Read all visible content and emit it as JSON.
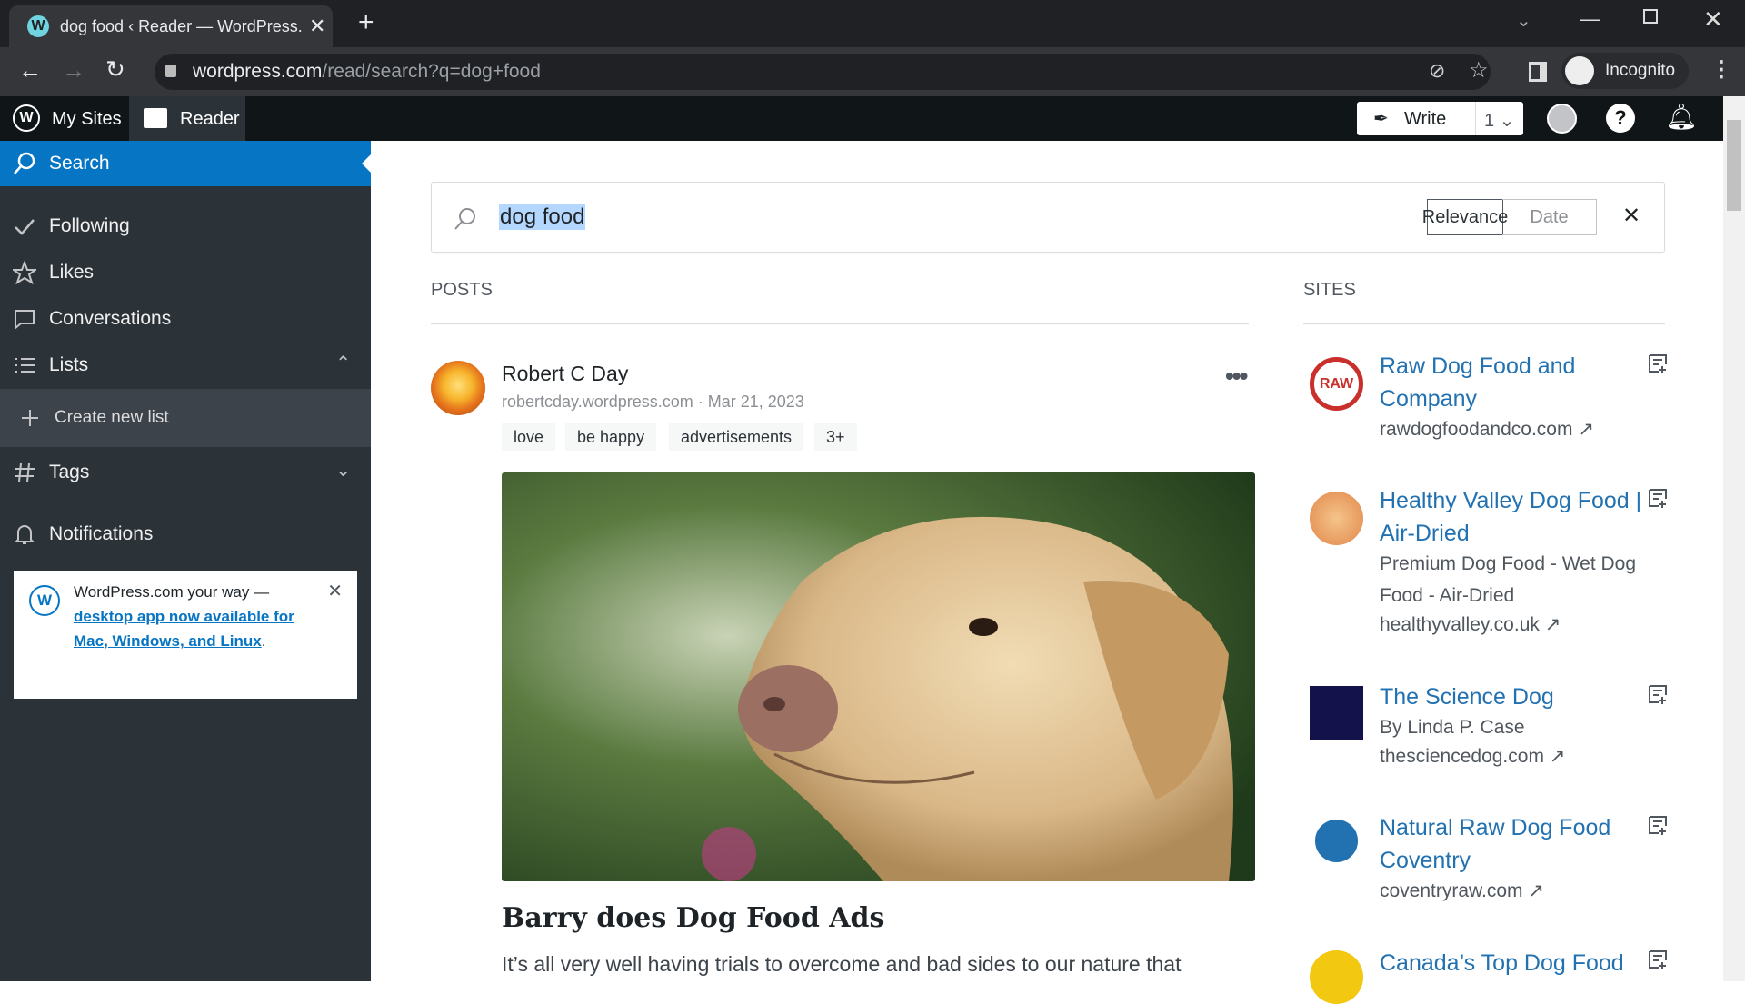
{
  "browser": {
    "tab_title": "dog food ‹ Reader — WordPress.com",
    "url_host": "wordpress.com",
    "url_path": "/read/search?q=dog+food",
    "profile": "Incognito"
  },
  "masterbar": {
    "my_sites": "My Sites",
    "reader": "Reader",
    "write": "Write",
    "draft_count": "1"
  },
  "sidebar": {
    "items": [
      {
        "label": "Search",
        "icon": "search-icon",
        "active": true
      },
      {
        "label": "Following",
        "icon": "checkmark-icon"
      },
      {
        "label": "Likes",
        "icon": "star-icon"
      },
      {
        "label": "Conversations",
        "icon": "comment-icon"
      },
      {
        "label": "Lists",
        "icon": "list-icon"
      },
      {
        "label": "Create new list",
        "icon": "plus-icon"
      },
      {
        "label": "Tags",
        "icon": "hash-icon"
      },
      {
        "label": "Notifications",
        "icon": "bell-icon"
      }
    ],
    "notice": {
      "text": "WordPress.com your way —",
      "link": "desktop app now available for Mac, Windows, and Linux",
      "end": "."
    }
  },
  "search": {
    "query": "dog food",
    "sort_relevance": "Relevance",
    "sort_date": "Date"
  },
  "posts": {
    "heading": "POSTS",
    "items": [
      {
        "author": "Robert C Day",
        "site": "robertcday.wordpress.com",
        "date": "Mar 21, 2023",
        "tags": [
          "love",
          "be happy",
          "advertisements",
          "3+"
        ],
        "title": "Barry does Dog Food Ads",
        "excerpt": "It’s all very well having trials to overcome and bad sides to our nature that"
      }
    ]
  },
  "sites": {
    "heading": "SITES",
    "items": [
      {
        "title": "Raw Dog Food and Company",
        "desc": "",
        "url": "rawdogfoodandco.com"
      },
      {
        "title": "Healthy Valley Dog Food | Air-Dried",
        "desc": "Premium Dog Food - Wet Dog Food - Air-Dried",
        "url": "healthyvalley.co.uk"
      },
      {
        "title": "The Science Dog",
        "desc": "By Linda P. Case",
        "url": "thesciencedog.com"
      },
      {
        "title": "Natural Raw Dog Food Coventry",
        "desc": "",
        "url": "coventryraw.com"
      },
      {
        "title": "Canada’s Top Dog Food",
        "desc": "",
        "url": ""
      }
    ]
  },
  "colors": {
    "accent": "#2271b1",
    "sidebar": "#2c3338",
    "active": "#0675c4"
  }
}
